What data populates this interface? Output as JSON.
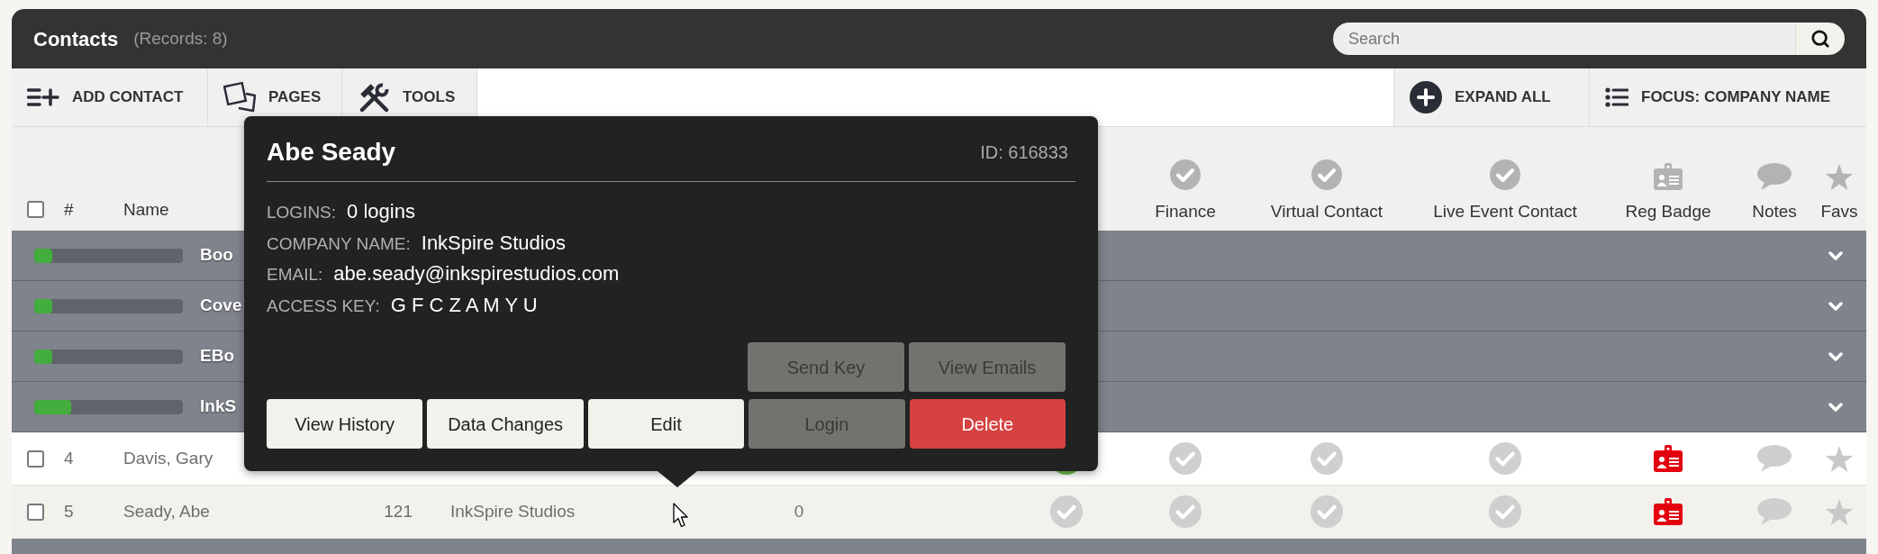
{
  "header": {
    "title": "Contacts",
    "record_count": "(Records: 8)",
    "search": {
      "placeholder": "Search"
    }
  },
  "toolbar": {
    "left": [
      {
        "kind": "add",
        "label": "ADD CONTACT"
      },
      {
        "kind": "pages",
        "label": "PAGES"
      },
      {
        "kind": "tools",
        "label": "TOOLS"
      }
    ],
    "right": [
      {
        "kind": "expand",
        "label": "EXPAND ALL"
      },
      {
        "kind": "focus",
        "label": "FOCUS: COMPANY NAME"
      }
    ]
  },
  "table": {
    "select_all": {
      "checked": false
    },
    "columns": [
      {
        "kind": "text",
        "label": "#"
      },
      {
        "kind": "text",
        "label": "Name"
      },
      {
        "kind": "check",
        "label": "Finance"
      },
      {
        "kind": "check",
        "label": "Virtual Contact"
      },
      {
        "kind": "check",
        "label": "Live Event Contact"
      },
      {
        "kind": "badge",
        "label": "Reg Badge"
      },
      {
        "kind": "notes",
        "label": "Notes"
      },
      {
        "kind": "star",
        "label": "Favs"
      }
    ],
    "groups": [
      {
        "label": "Boo",
        "level": 0.12,
        "expanded": false
      },
      {
        "label": "Cove",
        "level": 0.12,
        "expanded": false
      },
      {
        "label": "EBo",
        "level": 0.12,
        "expanded": false
      },
      {
        "label": "InkS",
        "level": 0.25,
        "expanded": false
      }
    ],
    "rows": [
      {
        "checked": false,
        "number": "4",
        "name": "Davis, Gary",
        "column_7": {
          "checked": true
        },
        "finance": {
          "checked": false
        },
        "virtual_contact": {
          "checked": false
        },
        "live_event_contact": {
          "checked": false
        },
        "reg_badge": {
          "alert": true
        },
        "notes": {
          "present": false
        },
        "favorite": false
      },
      {
        "checked": false,
        "number": "5",
        "name": "Seady, Abe",
        "column_4": "121",
        "column_5": "InkSpire Studios",
        "column_6": "0",
        "column_7": {
          "checked": false
        },
        "finance": {
          "checked": false
        },
        "virtual_contact": {
          "checked": false
        },
        "live_event_contact": {
          "checked": false
        },
        "reg_badge": {
          "alert": true
        },
        "notes": {
          "present": false
        },
        "favorite": false
      }
    ]
  },
  "tooltip": {
    "title": "Abe Seady",
    "id": "ID: 616833",
    "fields": [
      {
        "label": "LOGINS:",
        "value": "0 logins"
      },
      {
        "label": "COMPANY NAME:",
        "value": "InkSpire Studios"
      },
      {
        "label": "EMAIL:",
        "value": "abe.seady@inkspirestudios.com"
      },
      {
        "label": "ACCESS KEY:",
        "value": "G F C Z A M Y U"
      }
    ],
    "button_rows": [
      {
        "buttons": [
          {
            "label": "Send Key",
            "kind": "default",
            "disabled": true
          },
          {
            "label": "View Emails",
            "kind": "default",
            "disabled": true
          }
        ]
      },
      {
        "buttons": [
          {
            "label": "View History",
            "kind": "default",
            "disabled": false
          },
          {
            "label": "Data Changes",
            "kind": "default",
            "disabled": false
          },
          {
            "label": "Edit",
            "kind": "default",
            "disabled": false
          },
          {
            "label": "Login",
            "kind": "default",
            "disabled": true
          },
          {
            "label": "Delete",
            "kind": "danger",
            "disabled": false
          }
        ]
      }
    ]
  }
}
